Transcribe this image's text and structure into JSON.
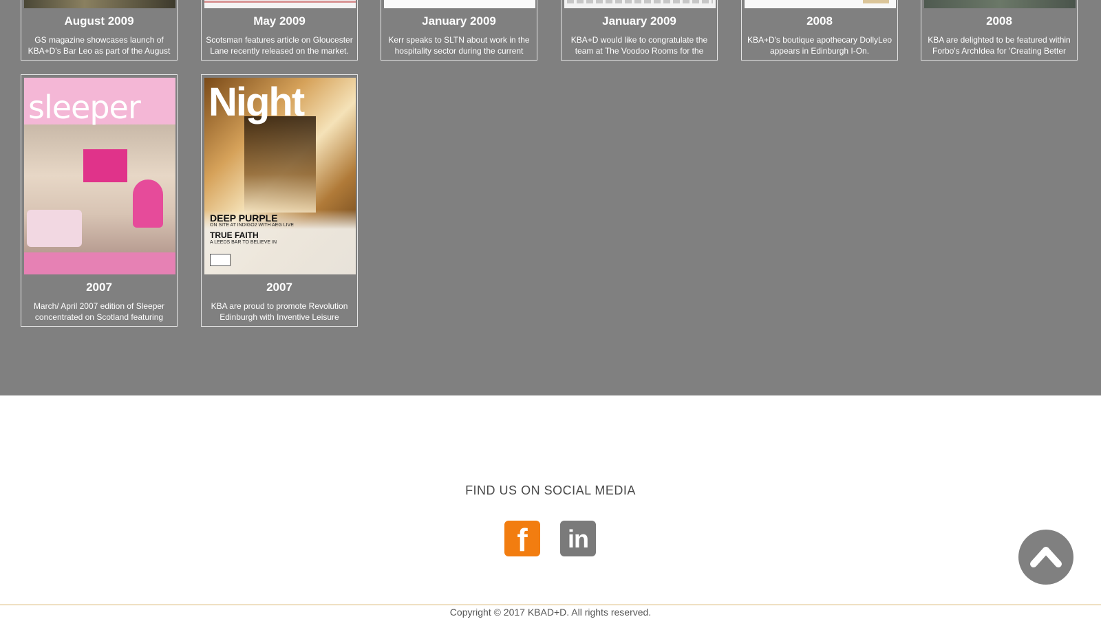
{
  "news": {
    "row1": [
      {
        "year": "August 2009",
        "text": "GS magazine showcases launch of KBA+D's Bar Leo as part of the August -"
      },
      {
        "year": "May 2009",
        "text": "Scotsman features article on Gloucester Lane recently released on the market."
      },
      {
        "year": "January 2009",
        "text": "Kerr speaks to SLTN about work in the hospitality sector during the current"
      },
      {
        "year": "January 2009",
        "text": "KBA+D would like to congratulate the team at The Voodoo Rooms for the"
      },
      {
        "year": "2008",
        "text": "KBA+D's boutique apothecary DollyLeo appears in Edinburgh I-On."
      },
      {
        "year": "2008",
        "text": "KBA are delighted to be featured within Forbo's ArchIdea for 'Creating Better"
      }
    ],
    "row2": [
      {
        "year": "2007",
        "text": "March/ April 2007 edition of Sleeper concentrated on Scotland featuring",
        "cover_title": "sleeper"
      },
      {
        "year": "2007",
        "text": "KBA are proud to promote Revolution Edinburgh with Inventive Leisure",
        "cover_title": "Night",
        "cover_headline_1": "DEEP PURPLE",
        "cover_sub_1": "ON SITE AT INDIGO2 WITH AEG LIVE",
        "cover_headline_2": "TRUE FAITH",
        "cover_sub_2": "A LEEDS BAR TO BELIEVE IN"
      }
    ]
  },
  "footer": {
    "social_title": "FIND US ON SOCIAL MEDIA",
    "facebook_glyph": "f",
    "linkedin_glyph": "in",
    "copyright": "Copyright © 2017 KBAD+D. All rights reserved."
  },
  "colors": {
    "gallery_bg": "#808080",
    "facebook": "#f27d10",
    "linkedin": "#7a7a7a",
    "divider": "#d9b46b"
  },
  "icons": {
    "facebook": "facebook-icon",
    "linkedin": "linkedin-icon",
    "back_to_top": "chevron-up-icon"
  }
}
